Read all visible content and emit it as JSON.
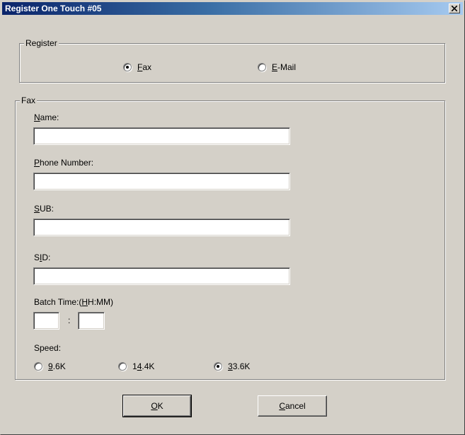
{
  "window": {
    "title": "Register One Touch #05"
  },
  "register_group": {
    "label": "Register",
    "options": [
      {
        "accel": "F",
        "rest": "ax",
        "checked": true
      },
      {
        "accel": "E",
        "rest": "-Mail",
        "checked": false
      }
    ]
  },
  "fax_group": {
    "label": "Fax",
    "name": {
      "accel": "N",
      "rest": "ame:",
      "value": ""
    },
    "phone": {
      "accel": "P",
      "rest": "hone Number:",
      "value": ""
    },
    "sub": {
      "accel": "S",
      "rest": "UB:",
      "value": ""
    },
    "sid": {
      "pre": "S",
      "accel": "I",
      "rest": "D:",
      "value": ""
    },
    "batch": {
      "pre": "Batch Time:(",
      "accel": "H",
      "rest": "H:MM)",
      "separator": ":",
      "hh": "",
      "mm": ""
    },
    "speed": {
      "label": "Speed:",
      "options": [
        {
          "pre": "",
          "accel": "9",
          "rest": ".6K",
          "checked": false
        },
        {
          "pre": "1",
          "accel": "4",
          "rest": ".4K",
          "checked": false
        },
        {
          "pre": "",
          "accel": "3",
          "rest": "3.6K",
          "checked": true
        }
      ]
    }
  },
  "buttons": {
    "ok": {
      "accel": "O",
      "rest": "K"
    },
    "cancel": {
      "accel": "C",
      "rest": "ancel"
    }
  }
}
